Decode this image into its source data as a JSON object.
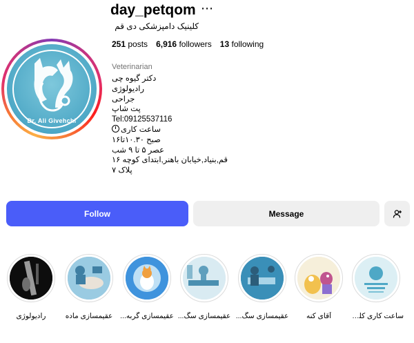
{
  "profile": {
    "username": "day_petqom",
    "more_icon": "more-horizontal-icon",
    "full_name": "کلینیک دامپزشکی دی قم",
    "avatar_caption": "Dr. Ali Givehchi",
    "stats": {
      "posts_count": "251",
      "posts_label": "posts",
      "followers_count": "6,916",
      "followers_label": "followers",
      "following_count": "13",
      "following_label": "following"
    },
    "category": "Veterinarian",
    "bio_lines": [
      "دکتر گیوه چی",
      "رادیولوژی",
      "جراحی",
      "پت شاپ",
      "Tel:09125537116",
      "ساعت کاری",
      "صبح ۱۰.۳۰تا۱۶",
      "عصر ۵ تا ۹ شب",
      "قم,بنیاد,خیابان باهنر,ابتدای کوچه ۱۶",
      "پلاک ۷"
    ]
  },
  "actions": {
    "follow_label": "Follow",
    "message_label": "Message",
    "add_user_icon": "add-user-icon"
  },
  "highlights": [
    {
      "label": "ساعت کاری کلی...",
      "icon": "clinic-card-image"
    },
    {
      "label": "آقای کنه",
      "icon": "tick-cartoon-image"
    },
    {
      "label": "عقیمسازی سگ...",
      "icon": "surgery-image"
    },
    {
      "label": "عقیمسازی سگ...",
      "icon": "surgery-image"
    },
    {
      "label": "عقیمسازی گربه...",
      "icon": "cat-cartoon-image"
    },
    {
      "label": "عقیمسازی ماده",
      "icon": "surgery-image"
    },
    {
      "label": "رادیولوژی",
      "icon": "xray-image"
    }
  ],
  "colors": {
    "follow_button": "#4a5df9",
    "secondary_button": "#efefef",
    "avatar_bg": "#4ea8c6"
  }
}
